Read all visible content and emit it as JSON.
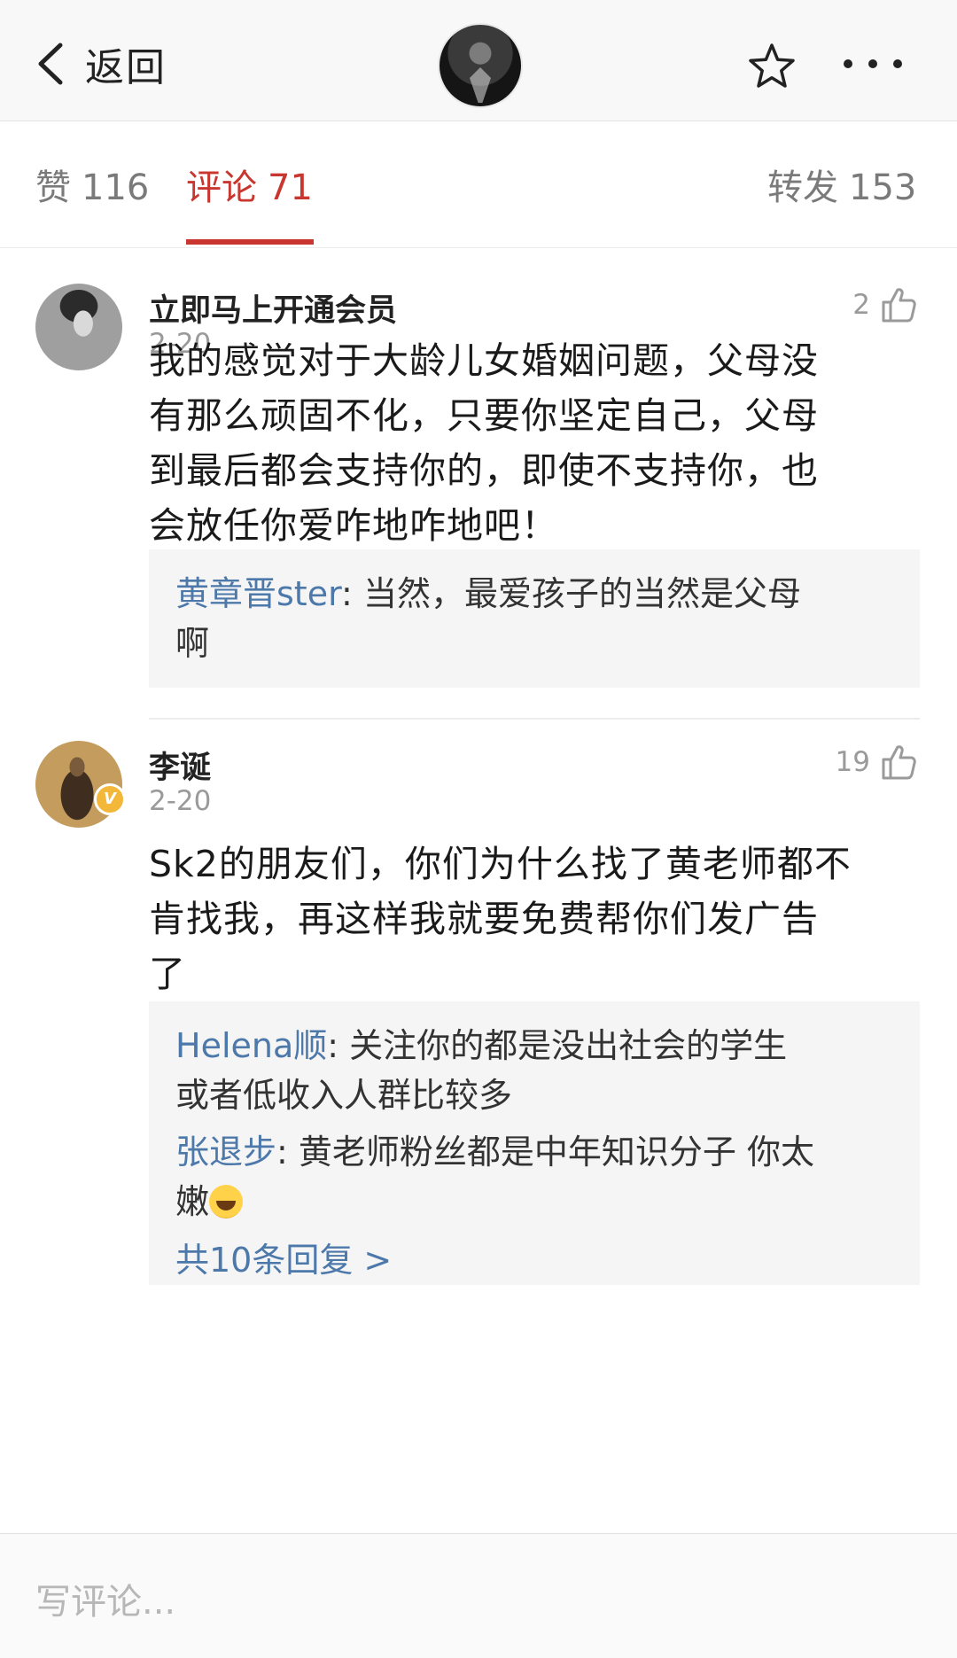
{
  "nav": {
    "back_label": "返回",
    "icons": [
      "chevron-left-icon",
      "star-icon",
      "more-icon"
    ]
  },
  "tabs": [
    {
      "label": "赞",
      "count": "116",
      "active": false
    },
    {
      "label": "评论",
      "count": "71",
      "active": true
    },
    {
      "label": "转发",
      "count": "153",
      "active": false
    }
  ],
  "colors": {
    "accent": "#c9362f",
    "link": "#4d78aa",
    "muted": "#9a9a9a",
    "reply_bg": "#f5f5f5",
    "verified_badge": "#f3b73a"
  },
  "comments": [
    {
      "user": "立即马上开通会员",
      "date": "2-20",
      "likes": "2",
      "verified": false,
      "lines": [
        "我的感觉对于大龄儿女婚姻问题，父母没",
        "有那么顽固不化，只要你坚定自己，父母",
        "到最后都会支持你的，即使不支持你，也",
        "会放任你爱咋地咋地吧！"
      ],
      "replies": [
        {
          "user": "黄章晋ster",
          "text_line1": "当然，最爱孩子的当然是父母",
          "text_line2": "啊"
        }
      ]
    },
    {
      "user": "李诞",
      "date": "2-20",
      "likes": "19",
      "verified": true,
      "verified_mark": "V",
      "lines": [
        "Sk2的朋友们，你们为什么找了黄老师都不",
        "肯找我，再这样我就要免费帮你们发广告",
        "了"
      ],
      "replies": [
        {
          "user": "Helena顺",
          "text_line1": "关注你的都是没出社会的学生",
          "text_line2": "或者低收入人群比较多"
        },
        {
          "user": "张退步",
          "text_line1": "黄老师粉丝都是中年知识分子 你太",
          "text_line2": "嫩",
          "emoji": "laughing-tears-emoji"
        }
      ],
      "more_replies": "共10条回复 >"
    }
  ],
  "compose": {
    "placeholder": "写评论..."
  }
}
